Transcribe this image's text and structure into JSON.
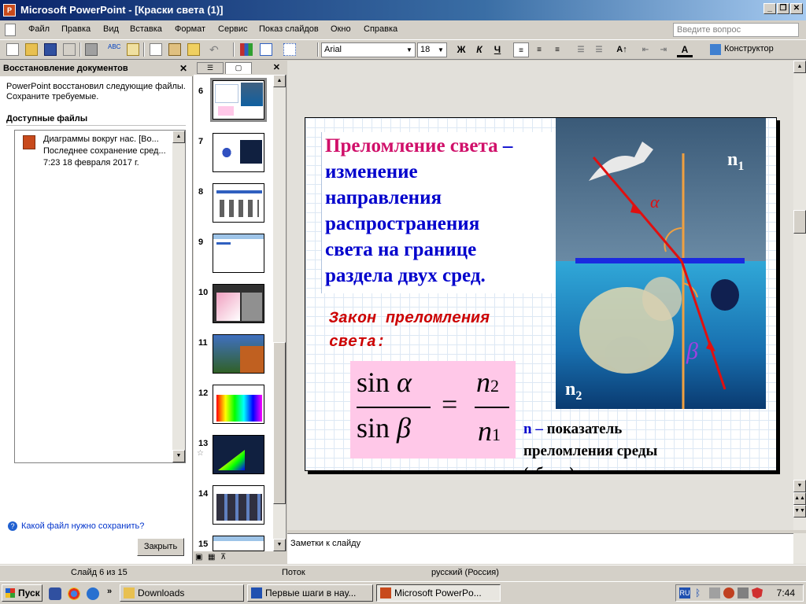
{
  "window": {
    "title": "Microsoft PowerPoint - [Краски света (1)]",
    "app_icon_text": "P"
  },
  "menu": {
    "items": [
      "Файл",
      "Правка",
      "Вид",
      "Вставка",
      "Формат",
      "Сервис",
      "Показ слайдов",
      "Окно",
      "Справка"
    ],
    "help_placeholder": "Введите вопрос"
  },
  "toolbar": {
    "font_name": "Arial",
    "font_size": "18",
    "bold": "Ж",
    "italic": "К",
    "underline": "Ч",
    "designer": "Конструктор"
  },
  "task_pane": {
    "title": "Восстановление документов",
    "message_line1": "PowerPoint восстановил следующие файлы.",
    "message_line2": "Сохраните требуемые.",
    "available_files": "Доступные файлы",
    "file": {
      "line1": "Диаграммы вокруг нас. [Во...",
      "line2": "Последнее сохранение сред...",
      "line3": "7:23 18 февраля 2017 г."
    },
    "help_link": "Какой файл нужно сохранить?",
    "close_button": "Закрыть"
  },
  "slides_panel": {
    "slides": [
      {
        "num": "6",
        "selected": true
      },
      {
        "num": "7"
      },
      {
        "num": "8"
      },
      {
        "num": "9"
      },
      {
        "num": "10"
      },
      {
        "num": "11"
      },
      {
        "num": "12"
      },
      {
        "num": "13"
      },
      {
        "num": "14"
      },
      {
        "num": "15"
      }
    ]
  },
  "slide": {
    "definition": {
      "term": "Преломление света",
      "dash": " –",
      "line2": "изменение",
      "line3": "направления",
      "line4": "распространения",
      "line5": "света на границе",
      "line6": "раздела двух сред."
    },
    "law_line1": "Закон преломления",
    "law_line2": "света:",
    "formula": {
      "num_left": "sin ",
      "alpha": "α",
      "den_left": "sin ",
      "beta": "β",
      "equals": "=",
      "n": "n",
      "sub2": "2",
      "sub1": "1"
    },
    "n_desc": {
      "letter": "n",
      "dash": " – ",
      "line1": "показатель",
      "line2": "преломления среды",
      "line3": "(абсол.)"
    },
    "photo": {
      "n1": "n",
      "n1_sub": "1",
      "n2": "n",
      "n2_sub": "2",
      "alpha": "α",
      "beta": "β"
    }
  },
  "notes": {
    "placeholder": "Заметки к слайду"
  },
  "status": {
    "slide_info": "Слайд 6 из 15",
    "design": "Поток",
    "language": "русский (Россия)"
  },
  "taskbar": {
    "start": "Пуск",
    "tasks": [
      {
        "label": "Downloads"
      },
      {
        "label": "Первые шаги в нау..."
      },
      {
        "label": "Microsoft PowerPo...",
        "active": true
      }
    ],
    "tray_lang": "RU",
    "clock": "7:44"
  },
  "colors": {
    "title_bar": "#0a246a",
    "definition_text": "#0000cc",
    "definition_term": "#d0106a",
    "law_text": "#cc0000",
    "formula_bg": "#ffc8e8"
  }
}
